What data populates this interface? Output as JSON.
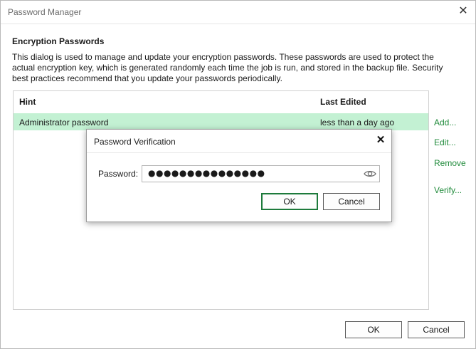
{
  "window": {
    "title": "Password Manager",
    "close_icon": "close-icon"
  },
  "section": {
    "title": "Encryption Passwords",
    "description": "This dialog is used to manage and update your encryption passwords. These passwords are used to protect the actual encryption key, which is generated randomly each time the job is run, and stored in the backup file. Security best practices recommend that you update your passwords periodically."
  },
  "table": {
    "columns": [
      "Hint",
      "Last Edited"
    ],
    "rows": [
      {
        "hint": "Administrator password",
        "last_edited": "less than a day ago",
        "selected": true
      }
    ],
    "selected_row_color": "#c3f1d3"
  },
  "side_actions": [
    "Add...",
    "Edit...",
    "Remove",
    "Verify..."
  ],
  "footer": {
    "ok_label": "OK",
    "cancel_label": "Cancel"
  },
  "verification_dialog": {
    "title": "Password Verification",
    "password_label": "Password:",
    "password_value": "●●●●●●●●●●●●●●●",
    "show_password_icon": "eye-icon",
    "ok_label": "OK",
    "cancel_label": "Cancel"
  },
  "colors": {
    "accent": "#1d7a3b",
    "link": "#1f8a3a"
  }
}
